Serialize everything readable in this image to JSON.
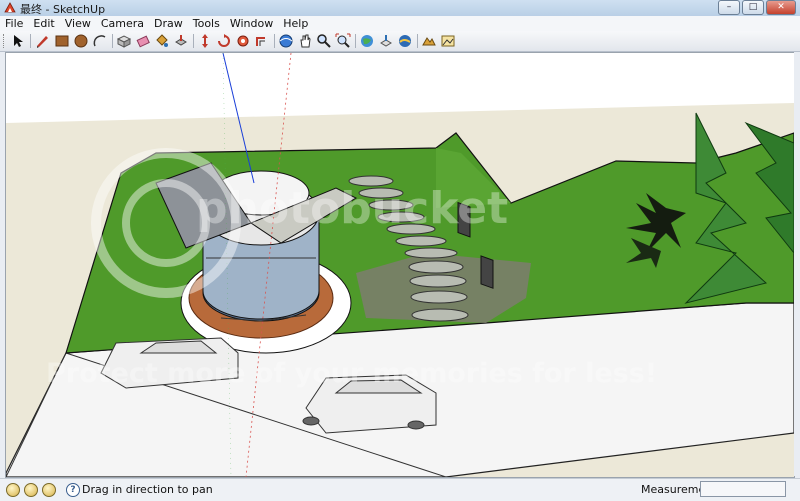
{
  "window": {
    "title": "最终 - SketchUp"
  },
  "menubar": {
    "items": [
      "File",
      "Edit",
      "View",
      "Camera",
      "Draw",
      "Tools",
      "Window",
      "Help"
    ]
  },
  "toolbar": {
    "tools": [
      "select-icon",
      "pencil-icon",
      "rectangle-icon",
      "circle-icon",
      "arc-icon",
      "make-component-icon",
      "eraser-icon",
      "paint-bucket-icon",
      "push-pull-icon",
      "move-icon",
      "rotate-icon",
      "follow-me-icon",
      "offset-icon",
      "tape-measure-icon",
      "orbit-icon",
      "pan-icon",
      "zoom-icon",
      "zoom-extents-icon",
      "get-models-icon",
      "share-model-icon",
      "google-earth-icon",
      "sandbox-icon",
      "photo-match-icon"
    ]
  },
  "watermark": {
    "brand": "photobucket",
    "tagline": "Protect more of your memories for less!"
  },
  "status": {
    "hint": "Drag in direction to pan",
    "measurements_label": "Measurements",
    "measurements_value": ""
  },
  "colors": {
    "sky": "#ffffff",
    "ground": "#ece8d8",
    "grass": "#4f9a2a",
    "road": "#f5f5f5",
    "accent_blue": "#3a5f8f"
  }
}
